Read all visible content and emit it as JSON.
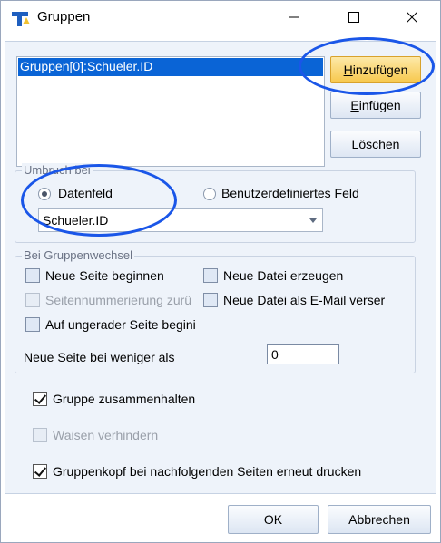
{
  "window": {
    "title": "Gruppen"
  },
  "list": {
    "items": [
      "Gruppen[0]:Schueler.ID"
    ]
  },
  "buttons": {
    "add": {
      "mnemonic": "H",
      "rest": "inzufügen"
    },
    "insert": {
      "mnemonic": "E",
      "rest": "infügen"
    },
    "delete_pre": "L",
    "delete_mnemonic": "ö",
    "delete_rest": "schen",
    "ok": "OK",
    "cancel": "Abbrechen"
  },
  "umbruch": {
    "group_label": "Umbruch bei",
    "radio_datafield": "Datenfeld",
    "radio_custom": "Benutzerdefiniertes Feld",
    "selected": "Datenfeld",
    "combo_value": "Schueler.ID"
  },
  "gruppenwechsel": {
    "group_label": "Bei Gruppenwechsel",
    "new_page": "Neue Seite beginnen",
    "new_file": "Neue Datei erzeugen",
    "page_numbering": "Seitennummerierung zurü",
    "email_file": "Neue Datei als E-Mail verser",
    "odd_page": "Auf ungerader Seite begini",
    "new_page_less_label": "Neue Seite bei weniger als",
    "new_page_less_value": "0"
  },
  "options": {
    "keep_together": "Gruppe zusammenhalten",
    "prevent_orphans": "Waisen verhindern",
    "reprint_header": "Gruppenkopf bei nachfolgenden Seiten erneut drucken"
  },
  "icons": {
    "app": "report-app-icon",
    "minimize": "minimize-icon",
    "maximize": "maximize-icon",
    "close": "close-icon"
  },
  "colors": {
    "selection": "#0a64d6",
    "highlight_button": "#f7c84d",
    "annotation": "#1a56e8",
    "dialog_bg": "#eef3fa"
  }
}
